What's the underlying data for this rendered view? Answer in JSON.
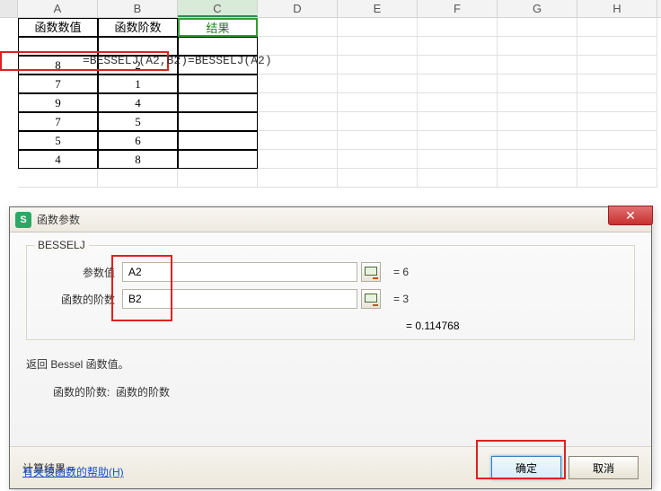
{
  "columns": [
    "A",
    "B",
    "C",
    "D",
    "E",
    "F",
    "G",
    "H"
  ],
  "headers": {
    "a": "函数数值",
    "b": "函数阶数",
    "c": "结果"
  },
  "formula_display": "=BESSELJ(A2,B2)=BESSELJ(A2)",
  "rows": [
    {
      "a": "8",
      "b": "2"
    },
    {
      "a": "7",
      "b": "1"
    },
    {
      "a": "9",
      "b": "4"
    },
    {
      "a": "7",
      "b": "5"
    },
    {
      "a": "5",
      "b": "6"
    },
    {
      "a": "4",
      "b": "8"
    }
  ],
  "dialog": {
    "title": "函数参数",
    "function_name": "BESSELJ",
    "params": [
      {
        "label": "参数值",
        "value": "A2",
        "eq": "= 6"
      },
      {
        "label": "函数的阶数",
        "value": "B2",
        "eq": "= 3"
      }
    ],
    "preview": "= 0.114768",
    "description": "返回 Bessel 函数值。",
    "arg_desc_label": "函数的阶数:",
    "arg_desc_text": "函数的阶数",
    "calc_result_label": "计算结果 =",
    "help_link": "有关该函数的帮助(H)",
    "ok": "确定",
    "cancel": "取消"
  }
}
